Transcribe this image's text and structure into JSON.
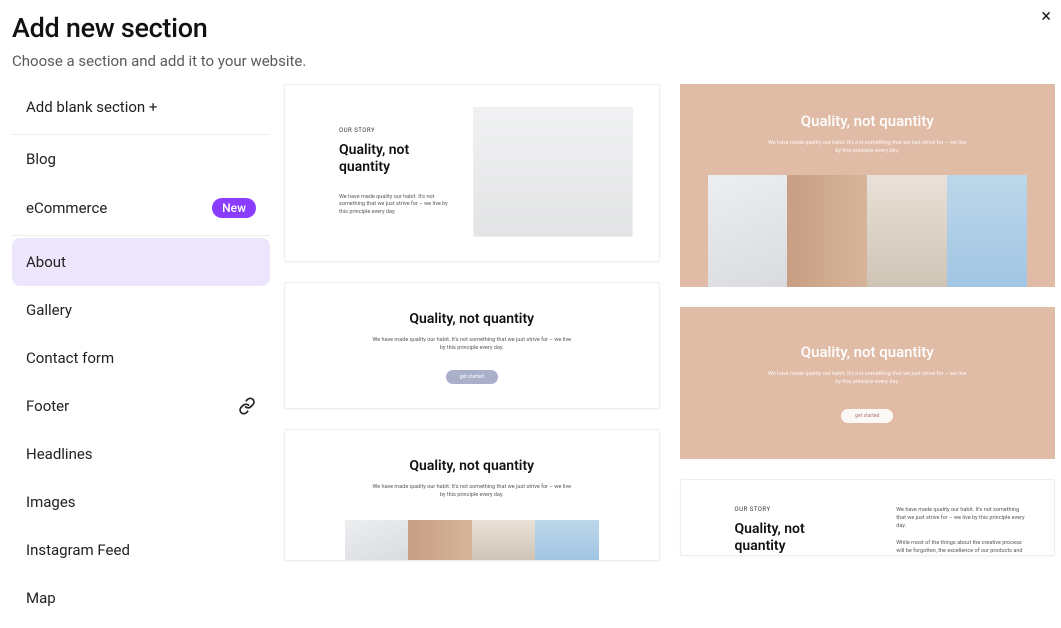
{
  "header": {
    "title": "Add new section",
    "subtitle": "Choose a section and add it to your website.",
    "close_label": "×"
  },
  "sidebar": {
    "add_blank": "Add blank section +",
    "categories": [
      {
        "label": "Blog",
        "badge": "",
        "icon": "",
        "active": false
      },
      {
        "label": "eCommerce",
        "badge": "New",
        "icon": "",
        "active": false
      },
      {
        "label": "About",
        "badge": "",
        "icon": "",
        "active": true
      },
      {
        "label": "Gallery",
        "badge": "",
        "icon": "",
        "active": false
      },
      {
        "label": "Contact form",
        "badge": "",
        "icon": "",
        "active": false
      },
      {
        "label": "Footer",
        "badge": "",
        "icon": "link",
        "active": false
      },
      {
        "label": "Headlines",
        "badge": "",
        "icon": "",
        "active": false
      },
      {
        "label": "Images",
        "badge": "",
        "icon": "",
        "active": false
      },
      {
        "label": "Instagram Feed",
        "badge": "",
        "icon": "",
        "active": false
      },
      {
        "label": "Map",
        "badge": "",
        "icon": "",
        "active": false
      }
    ]
  },
  "previews": {
    "eyebrow": "OUR STORY",
    "heading": "Quality, not quantity",
    "body_default": "We have made quality our habit. It's not something that we just strive for – we live by this principle every day.",
    "body_light": "We have made quality our habit. It's not something that we just strive for – we live by this principle every day.",
    "body_extra": "While most of the things about the creative process will be forgotten, the excellence of our products and",
    "button": "get started"
  }
}
